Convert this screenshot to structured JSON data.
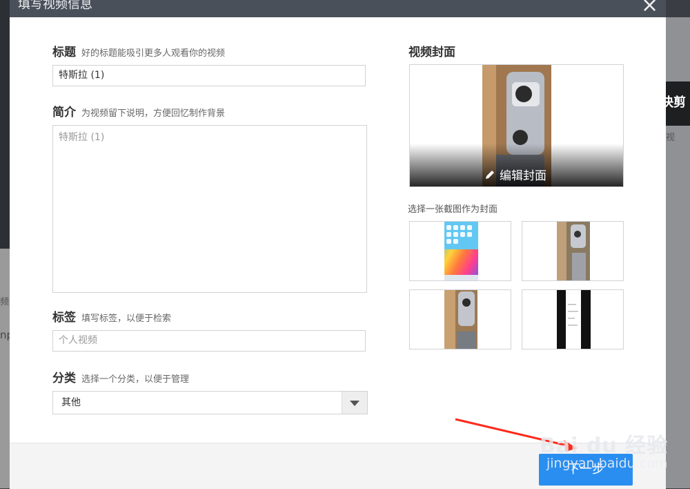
{
  "dialog": {
    "title": "填写视频信息"
  },
  "form": {
    "title": {
      "label": "标题",
      "hint": "好的标题能吸引更多人观看你的视频",
      "value": "特斯拉 (1)"
    },
    "intro": {
      "label": "简介",
      "hint": "为视频留下说明，方便回忆制作背景",
      "placeholder": "特斯拉 (1)"
    },
    "tags": {
      "label": "标签",
      "hint": "填写标签，以便于检索",
      "placeholder": "个人视频"
    },
    "category": {
      "label": "分类",
      "hint": "选择一个分类，以便于管理",
      "selected": "其他"
    }
  },
  "cover": {
    "title": "视频封面",
    "edit_label": "编辑封面",
    "pick_label": "选择一张截图作为封面"
  },
  "footer": {
    "next_label": "下一步"
  },
  "background": {
    "right_text": "快剪",
    "right_text2": "视",
    "left_text": "频",
    "left_text2": "np"
  },
  "watermark": {
    "line1": "Bai du 经验",
    "line2": "jingyan.baidu.com"
  },
  "colors": {
    "header": "#4a505a",
    "primary_button": "#2a8ef0",
    "arrow": "#ff2a1a"
  }
}
